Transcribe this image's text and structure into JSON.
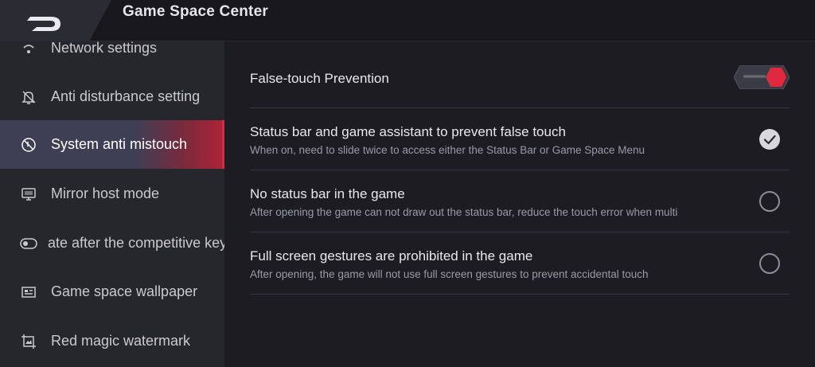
{
  "header": {
    "title": "Game Space Center"
  },
  "sidebar": {
    "items": [
      {
        "label": "Network settings",
        "icon": "network-icon"
      },
      {
        "label": "Anti disturbance setting",
        "icon": "bell-off-icon"
      },
      {
        "label": "System anti mistouch",
        "icon": "no-touch-icon",
        "active": true
      },
      {
        "label": "Mirror host mode",
        "icon": "monitor-icon"
      },
      {
        "label": "ate after the competitive key",
        "icon": "toggle-icon"
      },
      {
        "label": "Game space wallpaper",
        "icon": "wallpaper-icon"
      },
      {
        "label": "Red magic watermark",
        "icon": "watermark-icon"
      }
    ]
  },
  "main": {
    "false_touch": {
      "label": "False-touch Prevention",
      "enabled": true
    },
    "options": [
      {
        "title": "Status bar and game assistant to prevent false touch",
        "desc": "When on, need to slide twice to access either the Status Bar or Game Space Menu",
        "checked": true
      },
      {
        "title": "No status bar in the game",
        "desc": "After opening the game can not draw out the status bar, reduce the touch error when multi",
        "checked": false
      },
      {
        "title": "Full screen gestures are prohibited in the game",
        "desc": "After opening, the game will not use full screen gestures to prevent accidental touch",
        "checked": false
      }
    ]
  },
  "colors": {
    "accent_red": "#e0283f",
    "sidebar_bg": "#26262d",
    "main_bg": "#1c1c22"
  }
}
